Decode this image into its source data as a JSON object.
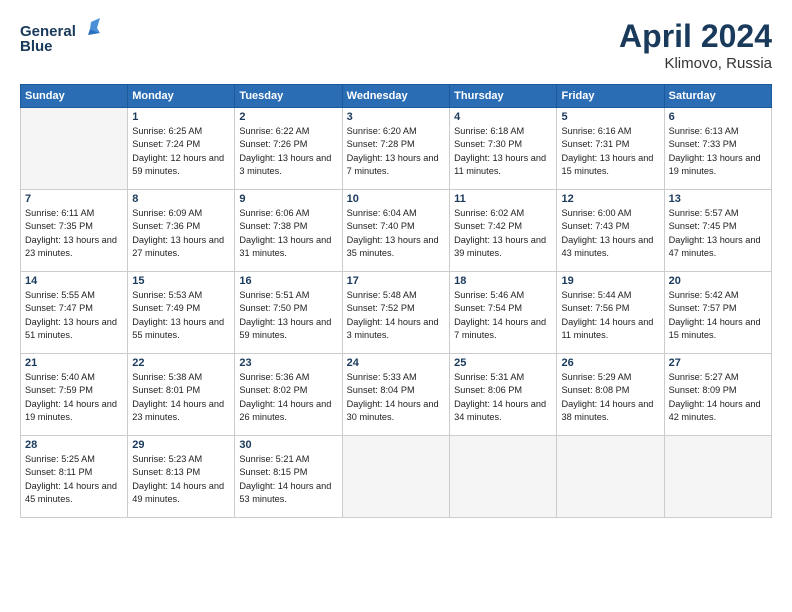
{
  "header": {
    "logo_line1": "General",
    "logo_line2": "Blue",
    "month_year": "April 2024",
    "location": "Klimovo, Russia"
  },
  "weekdays": [
    "Sunday",
    "Monday",
    "Tuesday",
    "Wednesday",
    "Thursday",
    "Friday",
    "Saturday"
  ],
  "weeks": [
    [
      {
        "day": "",
        "empty": true
      },
      {
        "day": "1",
        "sunrise": "6:25 AM",
        "sunset": "7:24 PM",
        "daylight": "12 hours and 59 minutes."
      },
      {
        "day": "2",
        "sunrise": "6:22 AM",
        "sunset": "7:26 PM",
        "daylight": "13 hours and 3 minutes."
      },
      {
        "day": "3",
        "sunrise": "6:20 AM",
        "sunset": "7:28 PM",
        "daylight": "13 hours and 7 minutes."
      },
      {
        "day": "4",
        "sunrise": "6:18 AM",
        "sunset": "7:30 PM",
        "daylight": "13 hours and 11 minutes."
      },
      {
        "day": "5",
        "sunrise": "6:16 AM",
        "sunset": "7:31 PM",
        "daylight": "13 hours and 15 minutes."
      },
      {
        "day": "6",
        "sunrise": "6:13 AM",
        "sunset": "7:33 PM",
        "daylight": "13 hours and 19 minutes."
      }
    ],
    [
      {
        "day": "7",
        "sunrise": "6:11 AM",
        "sunset": "7:35 PM",
        "daylight": "13 hours and 23 minutes."
      },
      {
        "day": "8",
        "sunrise": "6:09 AM",
        "sunset": "7:36 PM",
        "daylight": "13 hours and 27 minutes."
      },
      {
        "day": "9",
        "sunrise": "6:06 AM",
        "sunset": "7:38 PM",
        "daylight": "13 hours and 31 minutes."
      },
      {
        "day": "10",
        "sunrise": "6:04 AM",
        "sunset": "7:40 PM",
        "daylight": "13 hours and 35 minutes."
      },
      {
        "day": "11",
        "sunrise": "6:02 AM",
        "sunset": "7:42 PM",
        "daylight": "13 hours and 39 minutes."
      },
      {
        "day": "12",
        "sunrise": "6:00 AM",
        "sunset": "7:43 PM",
        "daylight": "13 hours and 43 minutes."
      },
      {
        "day": "13",
        "sunrise": "5:57 AM",
        "sunset": "7:45 PM",
        "daylight": "13 hours and 47 minutes."
      }
    ],
    [
      {
        "day": "14",
        "sunrise": "5:55 AM",
        "sunset": "7:47 PM",
        "daylight": "13 hours and 51 minutes."
      },
      {
        "day": "15",
        "sunrise": "5:53 AM",
        "sunset": "7:49 PM",
        "daylight": "13 hours and 55 minutes."
      },
      {
        "day": "16",
        "sunrise": "5:51 AM",
        "sunset": "7:50 PM",
        "daylight": "13 hours and 59 minutes."
      },
      {
        "day": "17",
        "sunrise": "5:48 AM",
        "sunset": "7:52 PM",
        "daylight": "14 hours and 3 minutes."
      },
      {
        "day": "18",
        "sunrise": "5:46 AM",
        "sunset": "7:54 PM",
        "daylight": "14 hours and 7 minutes."
      },
      {
        "day": "19",
        "sunrise": "5:44 AM",
        "sunset": "7:56 PM",
        "daylight": "14 hours and 11 minutes."
      },
      {
        "day": "20",
        "sunrise": "5:42 AM",
        "sunset": "7:57 PM",
        "daylight": "14 hours and 15 minutes."
      }
    ],
    [
      {
        "day": "21",
        "sunrise": "5:40 AM",
        "sunset": "7:59 PM",
        "daylight": "14 hours and 19 minutes."
      },
      {
        "day": "22",
        "sunrise": "5:38 AM",
        "sunset": "8:01 PM",
        "daylight": "14 hours and 23 minutes."
      },
      {
        "day": "23",
        "sunrise": "5:36 AM",
        "sunset": "8:02 PM",
        "daylight": "14 hours and 26 minutes."
      },
      {
        "day": "24",
        "sunrise": "5:33 AM",
        "sunset": "8:04 PM",
        "daylight": "14 hours and 30 minutes."
      },
      {
        "day": "25",
        "sunrise": "5:31 AM",
        "sunset": "8:06 PM",
        "daylight": "14 hours and 34 minutes."
      },
      {
        "day": "26",
        "sunrise": "5:29 AM",
        "sunset": "8:08 PM",
        "daylight": "14 hours and 38 minutes."
      },
      {
        "day": "27",
        "sunrise": "5:27 AM",
        "sunset": "8:09 PM",
        "daylight": "14 hours and 42 minutes."
      }
    ],
    [
      {
        "day": "28",
        "sunrise": "5:25 AM",
        "sunset": "8:11 PM",
        "daylight": "14 hours and 45 minutes."
      },
      {
        "day": "29",
        "sunrise": "5:23 AM",
        "sunset": "8:13 PM",
        "daylight": "14 hours and 49 minutes."
      },
      {
        "day": "30",
        "sunrise": "5:21 AM",
        "sunset": "8:15 PM",
        "daylight": "14 hours and 53 minutes."
      },
      {
        "day": "",
        "empty": true
      },
      {
        "day": "",
        "empty": true
      },
      {
        "day": "",
        "empty": true
      },
      {
        "day": "",
        "empty": true
      }
    ]
  ]
}
